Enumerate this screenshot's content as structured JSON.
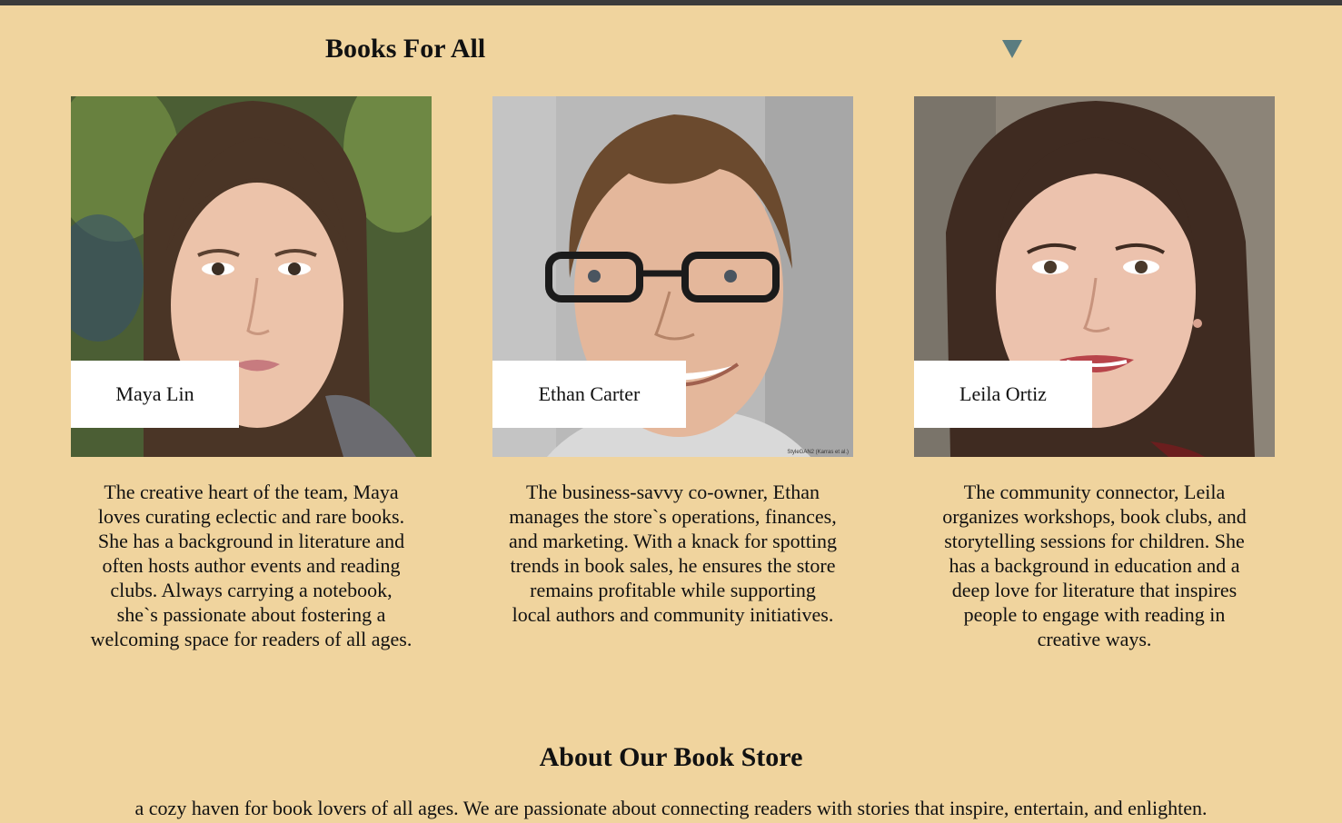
{
  "header": {
    "title": "Books For All",
    "menu_icon": "triangle-down-icon",
    "menu_icon_color": "#5a7c80"
  },
  "team": [
    {
      "name": "Maya Lin",
      "bio": "The creative heart of the team, Maya loves curating eclectic and rare books. She has a background in literature and often hosts author events and reading clubs. Always carrying a notebook, she`s passionate about fostering a welcoming space for readers of all ages."
    },
    {
      "name": "Ethan Carter",
      "bio": "The business-savvy co-owner, Ethan manages the store`s operations, finances, and marketing. With a knack for spotting trends in book sales, he ensures the store remains profitable while supporting local authors and community initiatives."
    },
    {
      "name": "Leila Ortiz",
      "bio": "The community connector, Leila organizes workshops, book clubs, and storytelling sessions for children. She has a background in education and a deep love for literature that inspires people to engage with reading in creative ways."
    }
  ],
  "about": {
    "title": "About Our Book Store",
    "text": "a cozy haven for book lovers of all ages. We are passionate about connecting readers with stories that inspire, entertain, and enlighten."
  },
  "photo_watermark": "StyleGAN2 (Karras et al.)",
  "colors": {
    "background": "#f0d49e",
    "top_bar": "#3b3b3b",
    "name_tag": "#ffffff"
  }
}
